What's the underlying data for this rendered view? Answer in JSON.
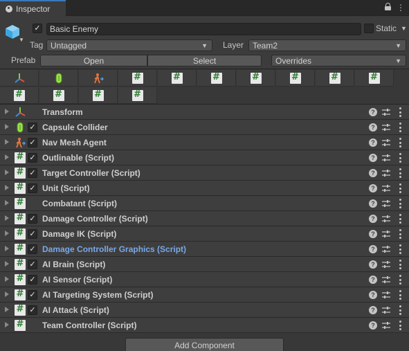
{
  "tab": {
    "title": "Inspector"
  },
  "header": {
    "name": "Basic Enemy",
    "active": true,
    "static_label": "Static",
    "static_checked": false,
    "tag_label": "Tag",
    "tag_value": "Untagged",
    "layer_label": "Layer",
    "layer_value": "Team2",
    "prefab_label": "Prefab",
    "open_label": "Open",
    "select_label": "Select",
    "overrides_label": "Overrides"
  },
  "icon_grid": [
    "transform-icon",
    "capsule-collider-icon",
    "nav-mesh-agent-icon",
    "script-icon",
    "script-icon",
    "script-icon",
    "script-icon",
    "script-icon",
    "script-icon",
    "script-icon",
    "script-icon",
    "script-icon",
    "script-icon",
    "script-icon"
  ],
  "components": [
    {
      "label": "Transform",
      "icon": "transform-icon",
      "has_toggle": false,
      "enabled": false,
      "highlight": false
    },
    {
      "label": "Capsule Collider",
      "icon": "capsule-collider-icon",
      "has_toggle": true,
      "enabled": true,
      "highlight": false
    },
    {
      "label": "Nav Mesh Agent",
      "icon": "nav-mesh-agent-icon",
      "has_toggle": true,
      "enabled": true,
      "highlight": false
    },
    {
      "label": "Outlinable (Script)",
      "icon": "script-icon",
      "has_toggle": true,
      "enabled": true,
      "highlight": false
    },
    {
      "label": "Target Controller (Script)",
      "icon": "script-icon",
      "has_toggle": true,
      "enabled": true,
      "highlight": false
    },
    {
      "label": "Unit (Script)",
      "icon": "script-icon",
      "has_toggle": true,
      "enabled": true,
      "highlight": false
    },
    {
      "label": "Combatant (Script)",
      "icon": "script-icon",
      "has_toggle": false,
      "enabled": false,
      "highlight": false
    },
    {
      "label": "Damage Controller (Script)",
      "icon": "script-icon",
      "has_toggle": true,
      "enabled": true,
      "highlight": false
    },
    {
      "label": "Damage IK (Script)",
      "icon": "script-icon",
      "has_toggle": true,
      "enabled": true,
      "highlight": false
    },
    {
      "label": "Damage Controller Graphics (Script)",
      "icon": "script-icon",
      "has_toggle": true,
      "enabled": true,
      "highlight": true
    },
    {
      "label": "AI Brain (Script)",
      "icon": "script-icon",
      "has_toggle": true,
      "enabled": true,
      "highlight": false
    },
    {
      "label": "AI Sensor (Script)",
      "icon": "script-icon",
      "has_toggle": true,
      "enabled": true,
      "highlight": false
    },
    {
      "label": "AI Targeting System (Script)",
      "icon": "script-icon",
      "has_toggle": true,
      "enabled": true,
      "highlight": false
    },
    {
      "label": "AI Attack (Script)",
      "icon": "script-icon",
      "has_toggle": true,
      "enabled": true,
      "highlight": false
    },
    {
      "label": "Team Controller (Script)",
      "icon": "script-icon",
      "has_toggle": false,
      "enabled": false,
      "highlight": false
    }
  ],
  "add_component_label": "Add Component",
  "colors": {
    "accent": "#3a79bb",
    "highlight_text": "#7aa8e8",
    "script_hash": "#2e7d32"
  }
}
